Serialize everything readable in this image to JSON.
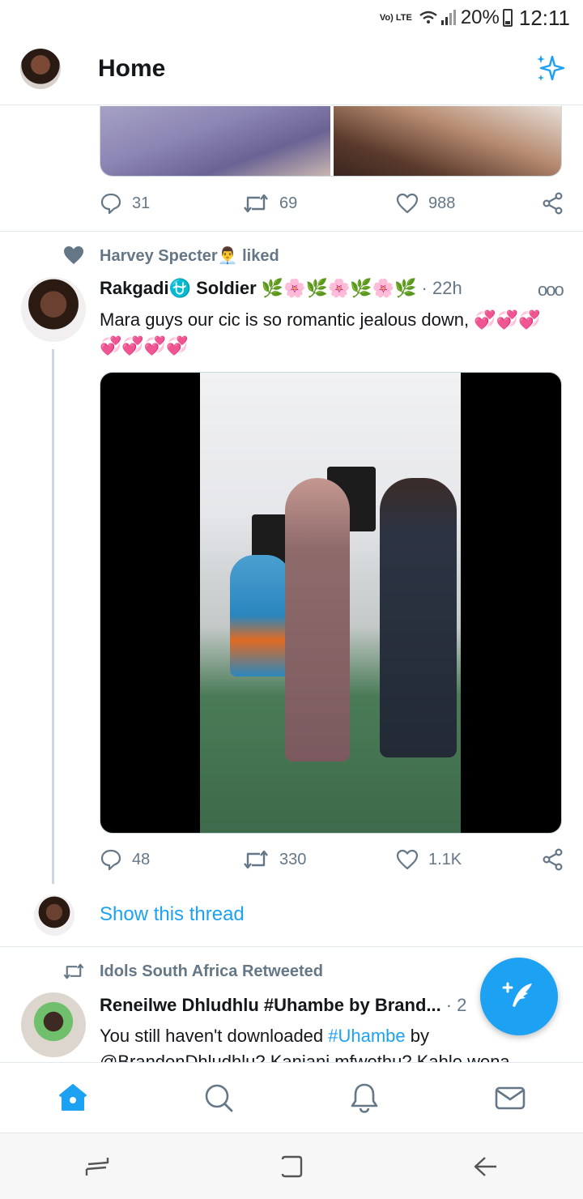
{
  "status_bar": {
    "network": "Vo) LTE",
    "battery": "20%",
    "time": "12:11"
  },
  "header": {
    "title": "Home"
  },
  "previous_tweet": {
    "replies": "31",
    "retweets": "69",
    "likes": "988"
  },
  "tweet": {
    "social_context": "Harvey Specter👨‍💼 liked",
    "author_name": "Rakgadi⛎ Soldier 🌿🌸🌿🌸🌿🌸🌿",
    "time": "· 22h",
    "text": "Mara guys our cic is so romantic jealous down, 💞💞💞💞💞💞💞",
    "replies": "48",
    "retweets": "330",
    "likes": "1.1K",
    "show_thread": "Show this thread"
  },
  "next_tweet": {
    "social_context": "Idols South Africa Retweeted",
    "author_name": "Reneilwe Dhludhlu #Uhambe by Brand...",
    "time": "· 2",
    "text_before": "You still haven't downloaded ",
    "hashtag": "#Uhambe",
    "text_after": " by",
    "line2": "@BrandonDhludhlu? Kanjani mfwethu? Kahle wena"
  },
  "colors": {
    "accent": "#1da1f2",
    "muted": "#657786",
    "text": "#14171a"
  }
}
